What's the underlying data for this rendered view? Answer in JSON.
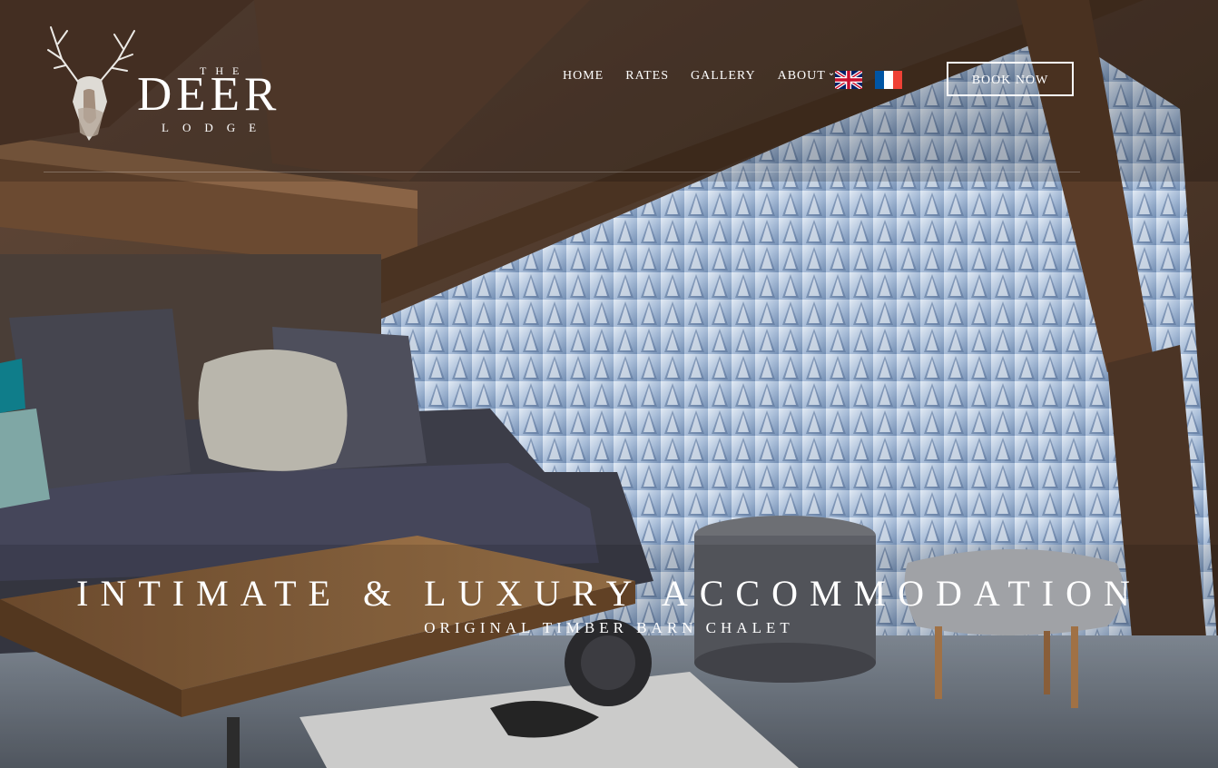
{
  "brand": {
    "the": "THE",
    "deer": "DEER",
    "lodge": "LODGE"
  },
  "nav": {
    "items": [
      {
        "label": "HOME"
      },
      {
        "label": "RATES"
      },
      {
        "label": "GALLERY"
      },
      {
        "label": "ABOUT",
        "has_dropdown": true
      }
    ]
  },
  "languages": [
    {
      "code": "en",
      "icon": "uk-flag-icon"
    },
    {
      "code": "fr",
      "icon": "france-flag-icon"
    }
  ],
  "header": {
    "cta_label": "BOOK NOW"
  },
  "hero": {
    "title": "INTIMATE & LUXURY ACCOMMODATION",
    "subtitle": "ORIGINAL TIMBER BARN CHALET"
  },
  "colors": {
    "text": "#ffffff",
    "wood": "#5c3f2a",
    "sofa": "#3c3d48",
    "snow": "#c9d8e8"
  }
}
